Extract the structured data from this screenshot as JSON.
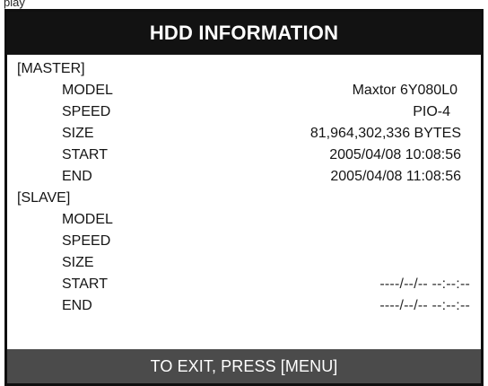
{
  "screen": {
    "top_fragment": "play",
    "title": "HDD INFORMATION",
    "footer": "TO EXIT, PRESS [MENU]"
  },
  "master": {
    "section_label": "[MASTER]",
    "labels": {
      "model": "MODEL",
      "speed": "SPEED",
      "size": "SIZE",
      "start": "START",
      "end": "END"
    },
    "values": {
      "model": "Maxtor 6Y080L0",
      "speed": "PIO-4",
      "size": "81,964,302,336 BYTES",
      "start": "2005/04/08 10:08:56",
      "end": "2005/04/08 11:08:56"
    }
  },
  "slave": {
    "section_label": "[SLAVE]",
    "labels": {
      "model": "MODEL",
      "speed": "SPEED",
      "size": "SIZE",
      "start": "START",
      "end": "END"
    },
    "values": {
      "start": "----/--/--  --:--:--",
      "end": "----/--/--  --:--:--"
    }
  },
  "colors": {
    "title_bar": "#121212",
    "footer_bar": "#4b4b4b",
    "panel_border": "#0f0f0f",
    "text": "#151515",
    "inverse_text": "#ffffff"
  }
}
